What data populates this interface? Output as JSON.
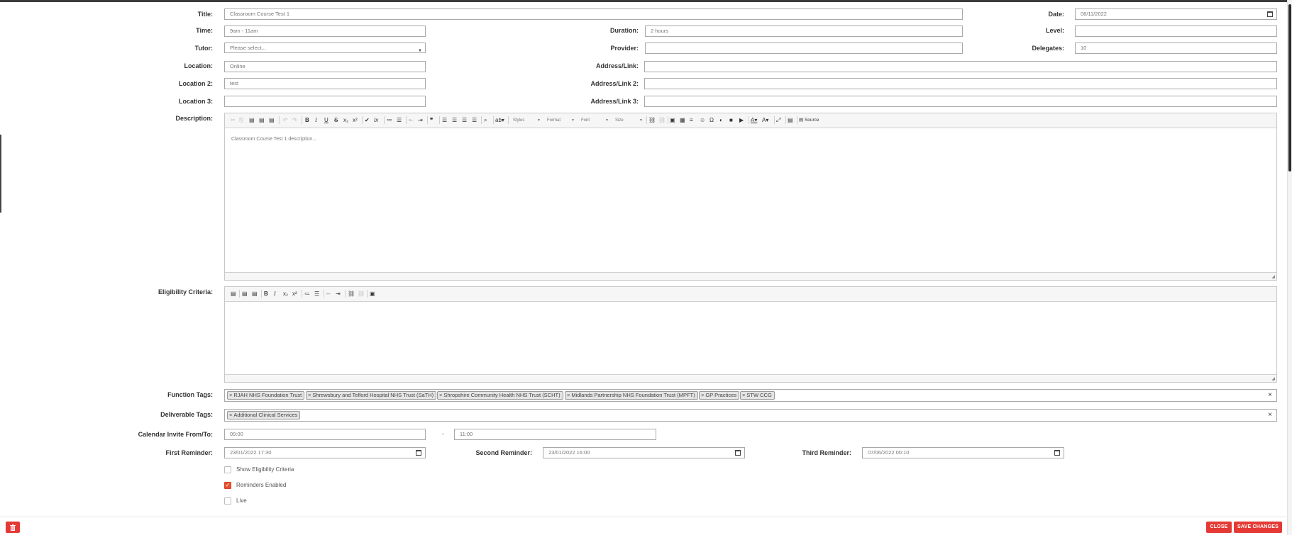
{
  "form": {
    "title_label": "Title:",
    "title_value": "Classroom Course Test 1",
    "date_label": "Date:",
    "date_value": "08/11/2022",
    "time_label": "Time:",
    "time_value": "9am - 11am",
    "duration_label": "Duration:",
    "duration_value": "2 hours",
    "level_label": "Level:",
    "level_value": "",
    "tutor_label": "Tutor:",
    "tutor_value": "Please select...",
    "provider_label": "Provider:",
    "provider_value": "",
    "delegates_label": "Delegates:",
    "delegates_value": "10",
    "location_label": "Location:",
    "location_value": "Online",
    "address_label": "Address/Link:",
    "address_value": "",
    "location2_label": "Location 2:",
    "location2_value": "test",
    "address2_label": "Address/Link 2:",
    "address2_value": "",
    "location3_label": "Location 3:",
    "location3_value": "",
    "address3_label": "Address/Link 3:",
    "address3_value": "",
    "description_label": "Description:",
    "description_value": "Classroom Course Test 1 description...",
    "eligibility_label": "Eligibility Criteria:",
    "function_tags_label": "Function Tags:",
    "deliverable_tags_label": "Deliverable Tags:",
    "calendar_label": "Calendar Invite From/To:",
    "calendar_from": "09:00",
    "calendar_sep": "-",
    "calendar_to": "11:00",
    "first_reminder_label": "First Reminder:",
    "first_reminder_value": "23/01/2022 17:30",
    "second_reminder_label": "Second Reminder:",
    "second_reminder_value": "23/01/2022 16:00",
    "third_reminder_label": "Third Reminder:",
    "third_reminder_value": "07/06/2022 00:10"
  },
  "editor": {
    "styles_label": "Styles",
    "format_label": "Format",
    "font_label": "Font",
    "size_label": "Size",
    "source_label": "Source"
  },
  "function_tags": [
    "RJAH NHS Foundation Trust",
    "Shrewsbury and Telford Hospital NHS Trust (SaTH)",
    "Shropshire Community Health NHS Trust (SCHT)",
    "Midlands Partnership NHS Foundation Trust (MPFT)",
    "GP Practices",
    "STW CCG"
  ],
  "deliverable_tags": [
    "Additional Clinical Services"
  ],
  "tag_remove_glyph": "×",
  "checkboxes": {
    "show_eligibility": {
      "label": "Show Eligibility Criteria",
      "checked": false
    },
    "reminders_enabled": {
      "label": "Reminders Enabled",
      "checked": true
    },
    "live": {
      "label": "Live",
      "checked": false
    }
  },
  "footer": {
    "close_label": "CLOSE",
    "save_label": "SAVE CHANGES"
  },
  "colors": {
    "accent": "#e53935",
    "checkbox_on": "#e8512f"
  }
}
